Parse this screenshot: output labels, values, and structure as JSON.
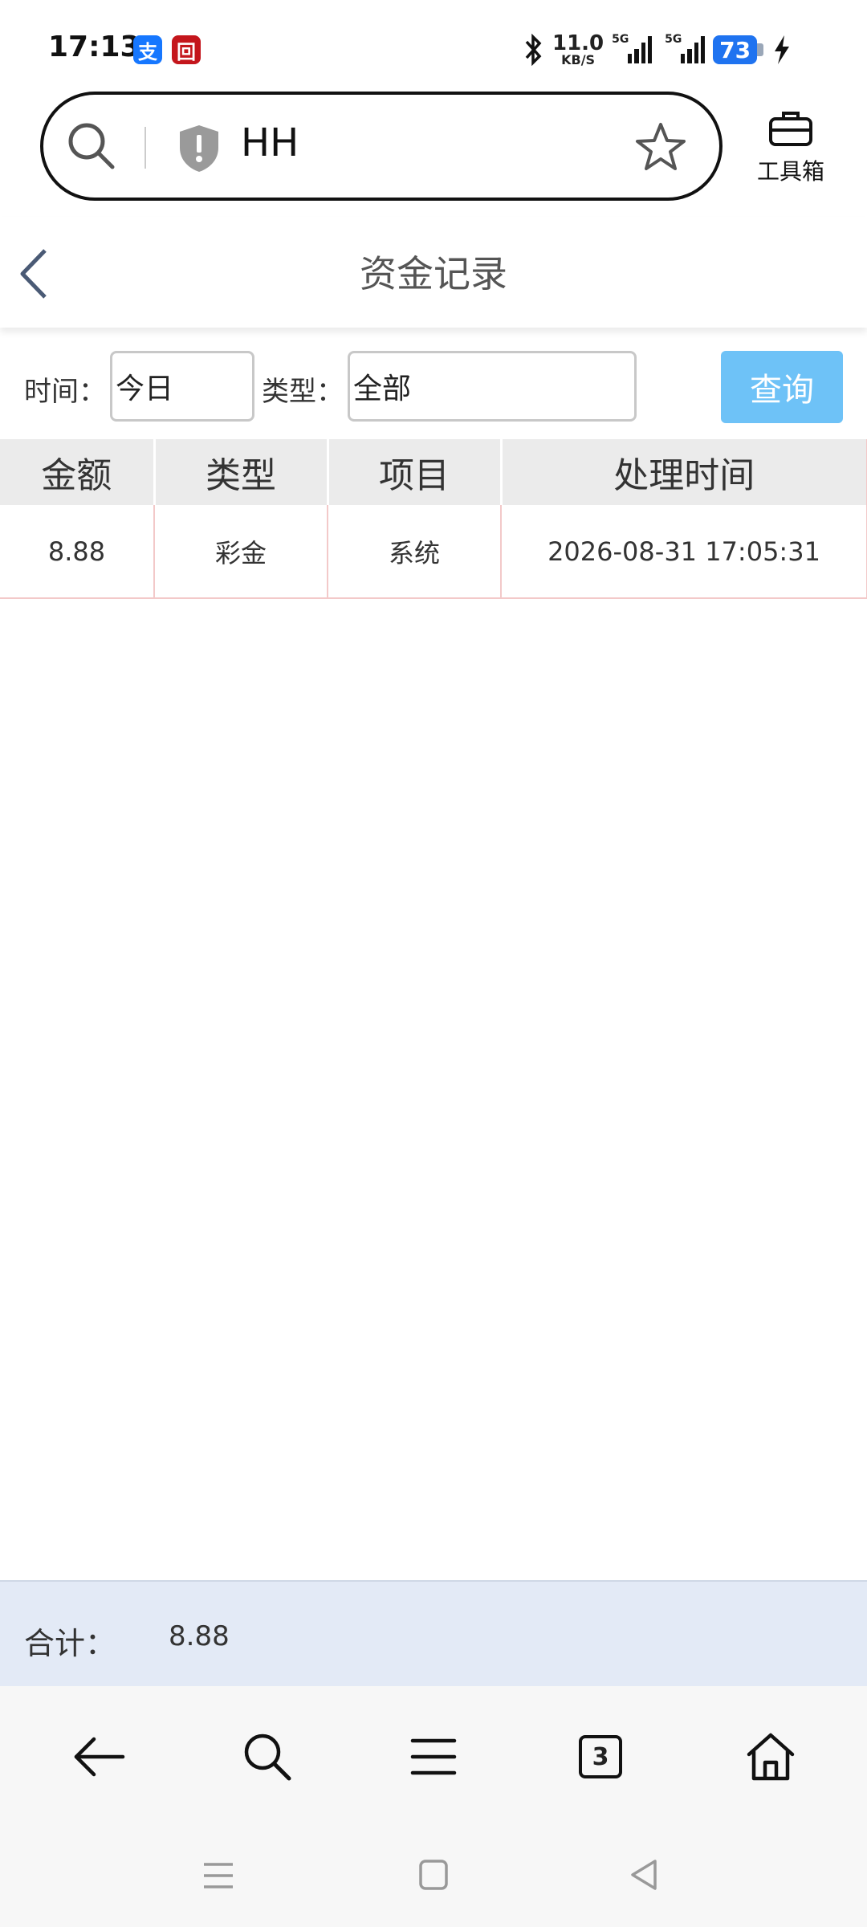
{
  "status_bar": {
    "time": "17:13",
    "app_badges": [
      {
        "icon": "alipay-icon",
        "text": "支",
        "color": "#1677ff"
      },
      {
        "icon": "bank-icon",
        "text": "回",
        "color": "#c4161c"
      }
    ],
    "net_speed_value": "11.0",
    "net_speed_unit": "KB/S",
    "signal_1_label": "5G",
    "signal_2_label": "5G",
    "battery": "73"
  },
  "browser": {
    "url_text": "HH",
    "toolbox_label": "工具箱",
    "tab_count": "3"
  },
  "page": {
    "title": "资金记录"
  },
  "filters": {
    "time_label": "时间：",
    "time_value": "今日",
    "type_label": "类型：",
    "type_value": "全部",
    "query_button": "查询"
  },
  "table": {
    "headers": [
      "金额",
      "类型",
      "项目",
      "处理时间"
    ],
    "rows": [
      [
        "8.88",
        "彩金",
        "系统",
        "2026-08-31 17:05:31"
      ]
    ]
  },
  "total": {
    "label": "合计：",
    "value": "8.88"
  },
  "colors": {
    "accent": "#6ec2f7",
    "total_bg": "#e3eaf6",
    "battery": "#1f73f0"
  }
}
